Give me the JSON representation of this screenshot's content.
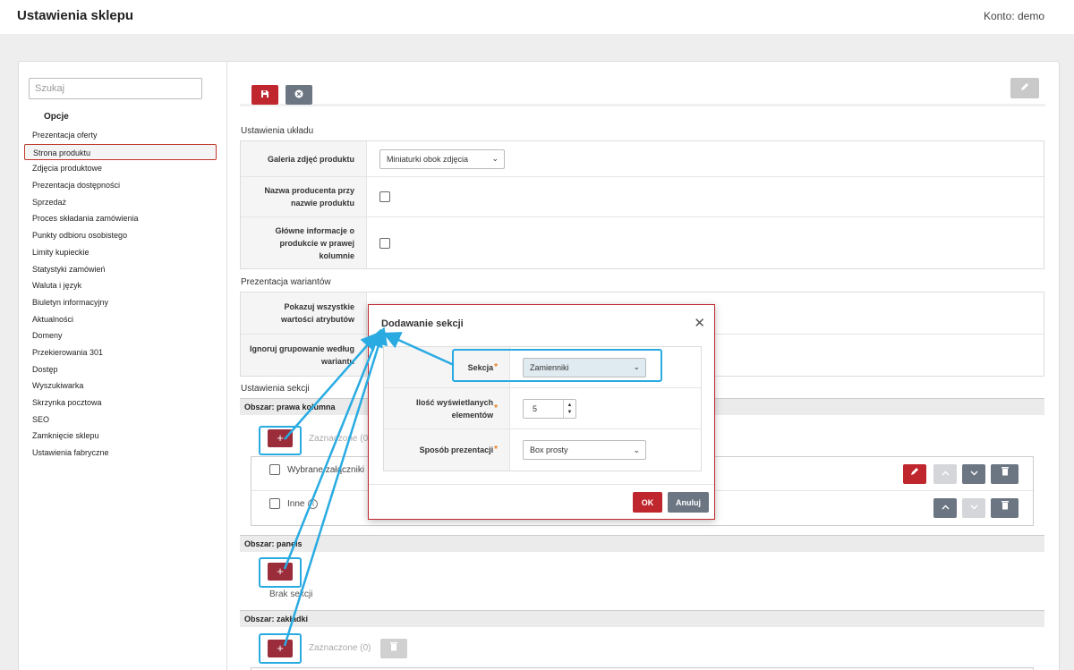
{
  "header": {
    "title": "Ustawienia sklepu",
    "account": "Konto: demo"
  },
  "sidebar": {
    "search_placeholder": "Szukaj",
    "heading": "Opcje",
    "items": [
      {
        "label": "Prezentacja oferty"
      },
      {
        "label": "Strona produktu",
        "active": true
      },
      {
        "label": "Zdjęcia produktowe"
      },
      {
        "label": "Prezentacja dostępności"
      },
      {
        "label": "Sprzedaż"
      },
      {
        "label": "Proces składania zamówienia"
      },
      {
        "label": "Punkty odbioru osobistego"
      },
      {
        "label": "Limity kupieckie"
      },
      {
        "label": "Statystyki zamówień"
      },
      {
        "label": "Waluta i język"
      },
      {
        "label": "Biuletyn informacyjny"
      },
      {
        "label": "Aktualności"
      },
      {
        "label": "Domeny"
      },
      {
        "label": "Przekierowania 301"
      },
      {
        "label": "Dostęp"
      },
      {
        "label": "Wyszukiwarka"
      },
      {
        "label": "Skrzynka pocztowa"
      },
      {
        "label": "SEO"
      },
      {
        "label": "Zamknięcie sklepu"
      },
      {
        "label": "Ustawienia fabryczne"
      }
    ]
  },
  "layout_settings": {
    "title": "Ustawienia układu",
    "gallery_label": "Galeria zdjęć produktu",
    "gallery_value": "Miniaturki obok zdjęcia",
    "producer_label": "Nazwa producenta przy nazwie produktu",
    "main_info_label": "Główne informacje o produkcie w prawej kolumnie"
  },
  "variants": {
    "title": "Prezentacja wariantów",
    "show_all_label": "Pokazuj wszystkie wartości atrybutów",
    "ignore_label": "Ignoruj grupowanie według wariantu"
  },
  "sections": {
    "title": "Ustawienia sekcji",
    "area_right": "Obszar: prawa kolumna",
    "selected_count": "Zaznaczone (0)",
    "item1": "Wybrane załączniki",
    "item2": "Inne",
    "area_panels": "Obszar: panels",
    "no_sections": "Brak sekcji",
    "area_tabs": "Obszar: zakładki",
    "selected_count_tabs": "Zaznaczone (0)",
    "add_symbol": "+"
  },
  "modal": {
    "title": "Dodawanie sekcji",
    "section_label": "Sekcja",
    "section_value": "Zamienniki",
    "count_label": "Ilość wyświetlanych elementów",
    "count_value": "5",
    "presentation_label": "Sposób prezentacji",
    "presentation_value": "Box prosty",
    "ok": "OK",
    "cancel": "Anuluj",
    "required_mark": "*"
  },
  "colors": {
    "accent_red": "#c0262d",
    "add_button": "#9b2c3a",
    "highlight": "#29abe2",
    "gray_button": "#6c7683"
  }
}
